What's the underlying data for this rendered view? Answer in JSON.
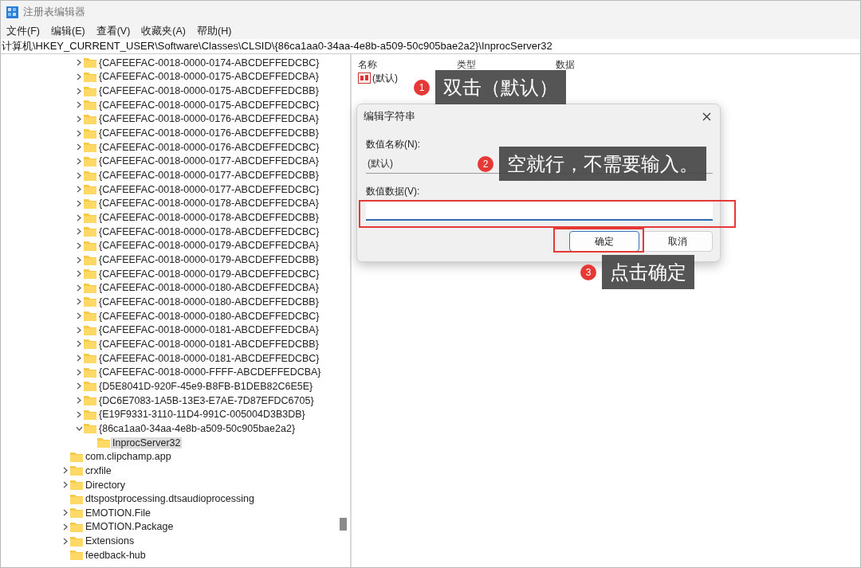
{
  "window": {
    "title": "注册表编辑器"
  },
  "menu": [
    {
      "label": "文件(F)"
    },
    {
      "label": "编辑(E)"
    },
    {
      "label": "查看(V)"
    },
    {
      "label": "收藏夹(A)"
    },
    {
      "label": "帮助(H)"
    }
  ],
  "address": "计算机\\HKEY_CURRENT_USER\\Software\\Classes\\CLSID\\{86ca1aa0-34aa-4e8b-a509-50c905bae2a2}\\InprocServer32",
  "tree": {
    "items": [
      {
        "children": [
          {
            "label": "{CAFEEFAC-0018-0000-0174-ABCDEFFEDCBC}",
            "has_children": true,
            "expanded": false,
            "selected": false
          },
          {
            "label": "{CAFEEFAC-0018-0000-0175-ABCDEFFEDCBA}",
            "has_children": true,
            "expanded": false,
            "selected": false
          },
          {
            "label": "{CAFEEFAC-0018-0000-0175-ABCDEFFEDCBB}",
            "has_children": true,
            "expanded": false,
            "selected": false
          },
          {
            "label": "{CAFEEFAC-0018-0000-0175-ABCDEFFEDCBC}",
            "has_children": true,
            "expanded": false,
            "selected": false
          },
          {
            "label": "{CAFEEFAC-0018-0000-0176-ABCDEFFEDCBA}",
            "has_children": true,
            "expanded": false,
            "selected": false
          },
          {
            "label": "{CAFEEFAC-0018-0000-0176-ABCDEFFEDCBB}",
            "has_children": true,
            "expanded": false,
            "selected": false
          },
          {
            "label": "{CAFEEFAC-0018-0000-0176-ABCDEFFEDCBC}",
            "has_children": true,
            "expanded": false,
            "selected": false
          },
          {
            "label": "{CAFEEFAC-0018-0000-0177-ABCDEFFEDCBA}",
            "has_children": true,
            "expanded": false,
            "selected": false
          },
          {
            "label": "{CAFEEFAC-0018-0000-0177-ABCDEFFEDCBB}",
            "has_children": true,
            "expanded": false,
            "selected": false
          },
          {
            "label": "{CAFEEFAC-0018-0000-0177-ABCDEFFEDCBC}",
            "has_children": true,
            "expanded": false,
            "selected": false
          },
          {
            "label": "{CAFEEFAC-0018-0000-0178-ABCDEFFEDCBA}",
            "has_children": true,
            "expanded": false,
            "selected": false
          },
          {
            "label": "{CAFEEFAC-0018-0000-0178-ABCDEFFEDCBB}",
            "has_children": true,
            "expanded": false,
            "selected": false
          },
          {
            "label": "{CAFEEFAC-0018-0000-0178-ABCDEFFEDCBC}",
            "has_children": true,
            "expanded": false,
            "selected": false
          },
          {
            "label": "{CAFEEFAC-0018-0000-0179-ABCDEFFEDCBA}",
            "has_children": true,
            "expanded": false,
            "selected": false
          },
          {
            "label": "{CAFEEFAC-0018-0000-0179-ABCDEFFEDCBB}",
            "has_children": true,
            "expanded": false,
            "selected": false
          },
          {
            "label": "{CAFEEFAC-0018-0000-0179-ABCDEFFEDCBC}",
            "has_children": true,
            "expanded": false,
            "selected": false
          },
          {
            "label": "{CAFEEFAC-0018-0000-0180-ABCDEFFEDCBA}",
            "has_children": true,
            "expanded": false,
            "selected": false
          },
          {
            "label": "{CAFEEFAC-0018-0000-0180-ABCDEFFEDCBB}",
            "has_children": true,
            "expanded": false,
            "selected": false
          },
          {
            "label": "{CAFEEFAC-0018-0000-0180-ABCDEFFEDCBC}",
            "has_children": true,
            "expanded": false,
            "selected": false
          },
          {
            "label": "{CAFEEFAC-0018-0000-0181-ABCDEFFEDCBA}",
            "has_children": true,
            "expanded": false,
            "selected": false
          },
          {
            "label": "{CAFEEFAC-0018-0000-0181-ABCDEFFEDCBB}",
            "has_children": true,
            "expanded": false,
            "selected": false
          },
          {
            "label": "{CAFEEFAC-0018-0000-0181-ABCDEFFEDCBC}",
            "has_children": true,
            "expanded": false,
            "selected": false
          },
          {
            "label": "{CAFEEFAC-0018-0000-FFFF-ABCDEFFEDCBA}",
            "has_children": true,
            "expanded": false,
            "selected": false
          },
          {
            "label": "{D5E8041D-920F-45e9-B8FB-B1DEB82C6E5E}",
            "has_children": true,
            "expanded": false,
            "selected": false
          },
          {
            "label": "{DC6E7083-1A5B-13E3-E7AE-7D87EFDC6705}",
            "has_children": true,
            "expanded": false,
            "selected": false
          },
          {
            "label": "{E19F9331-3110-11D4-991C-005004D3B3DB}",
            "has_children": true,
            "expanded": false,
            "selected": false
          },
          {
            "label": "{86ca1aa0-34aa-4e8b-a509-50c905bae2a2}",
            "has_children": true,
            "expanded": true,
            "selected": false,
            "children": [
              {
                "label": "InprocServer32",
                "has_children": false,
                "selected": true
              }
            ]
          }
        ]
      },
      {
        "label": "com.clipchamp.app",
        "has_children": false,
        "selected": false
      },
      {
        "label": "crxfile",
        "has_children": true,
        "expanded": false,
        "selected": false
      },
      {
        "label": "Directory",
        "has_children": true,
        "expanded": false,
        "selected": false
      },
      {
        "label": "dtspostprocessing.dtsaudioprocessing",
        "has_children": false,
        "selected": false
      },
      {
        "label": "EMOTION.File",
        "has_children": true,
        "expanded": false,
        "selected": false
      },
      {
        "label": "EMOTION.Package",
        "has_children": true,
        "expanded": false,
        "selected": false
      },
      {
        "label": "Extensions",
        "has_children": true,
        "expanded": false,
        "selected": false
      },
      {
        "label": "feedback-hub",
        "has_children": false,
        "selected": false
      }
    ]
  },
  "values": {
    "columns": [
      "名称",
      "类型",
      "数据"
    ],
    "rows": [
      {
        "name": "(默认)"
      }
    ]
  },
  "dialog": {
    "title": "编辑字符串",
    "name_label": "数值名称(N):",
    "name_value": "(默认)",
    "data_label": "数值数据(V):",
    "data_highlighted": true,
    "buttons": [
      {
        "label": "确定",
        "default": true,
        "highlighted": true
      },
      {
        "label": "取消",
        "default": false,
        "highlighted": false
      }
    ]
  },
  "annotations": [
    {
      "number": "1",
      "text": "双击（默认）"
    },
    {
      "number": "2",
      "text": "空就行，不需要输入。"
    },
    {
      "number": "3",
      "text": "点击确定"
    }
  ]
}
